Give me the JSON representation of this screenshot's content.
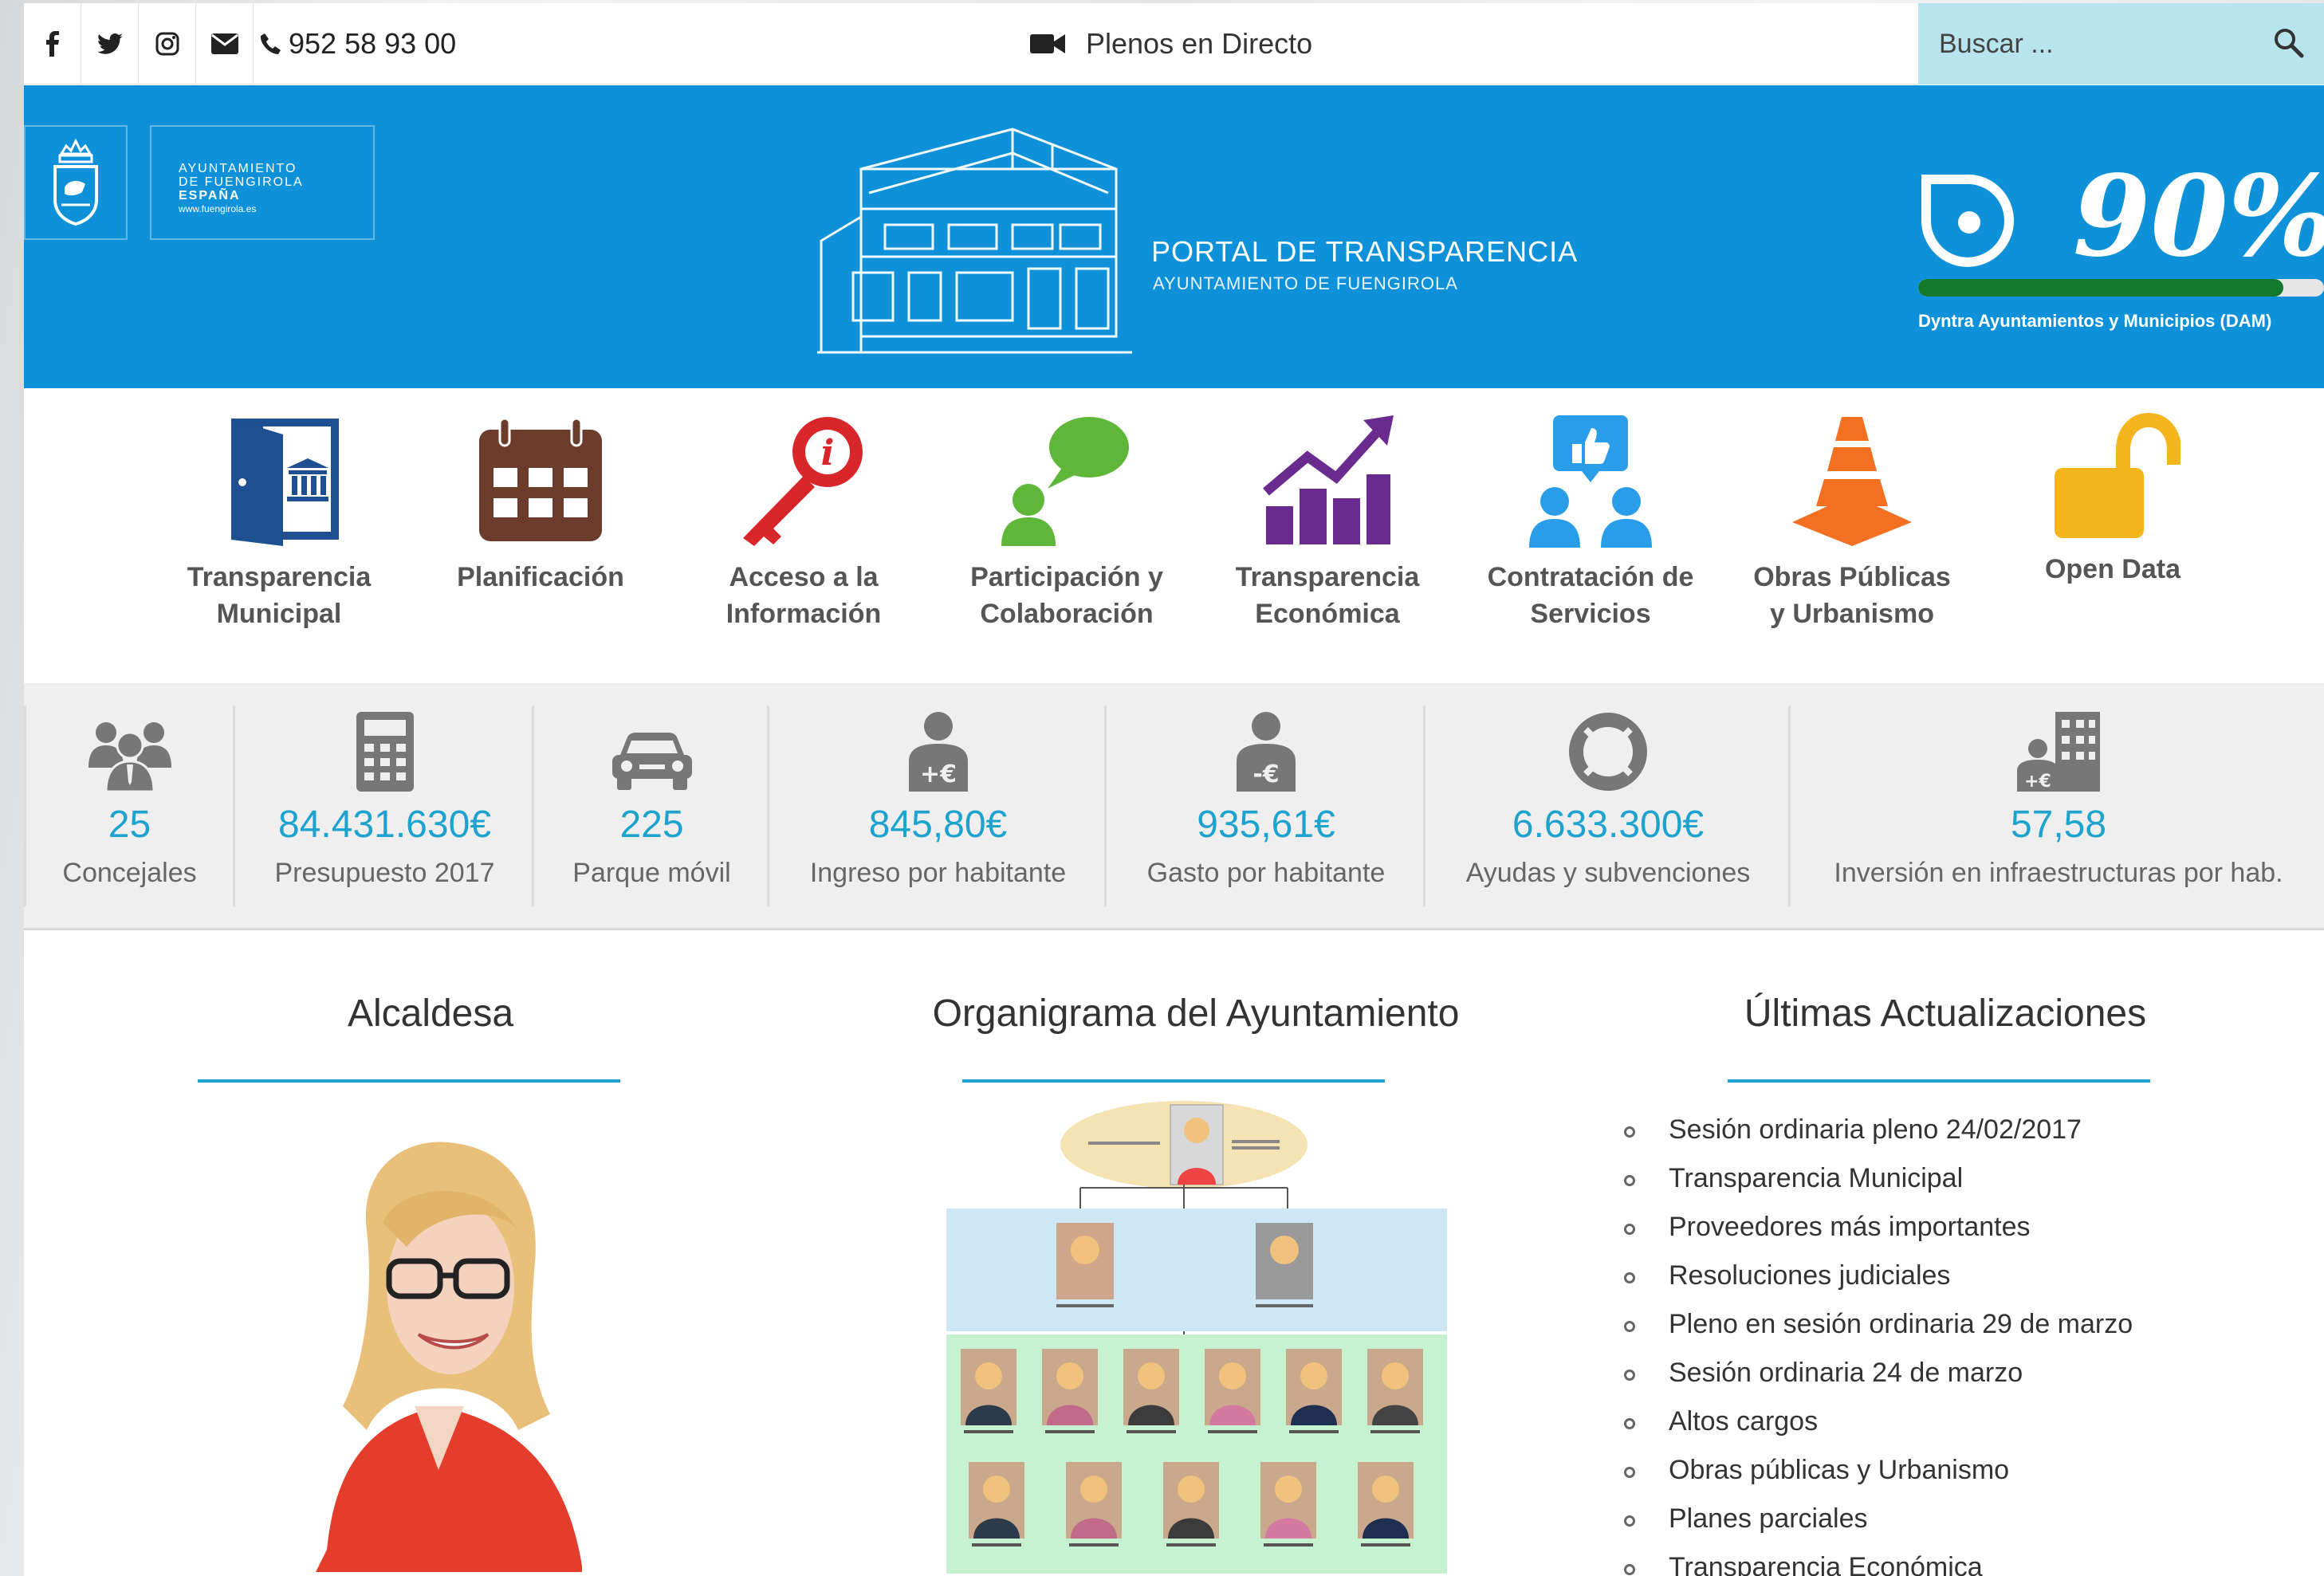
{
  "topbar": {
    "social": [
      "facebook-icon",
      "twitter-icon",
      "instagram-icon",
      "envelope-icon"
    ],
    "phone": "952 58 93 00",
    "live_label": "Plenos en Directo",
    "search_placeholder": "Buscar ..."
  },
  "hero": {
    "logo_lines": [
      "AYUNTAMIENTO",
      "DE FUENGIROLA",
      "ESPAÑA",
      "www.fuengirola.es"
    ],
    "portal_title": "PORTAL DE TRANSPARENCIA",
    "portal_subtitle": "AYUNTAMIENTO DE FUENGIROLA",
    "score": "90%",
    "score_progress": 0.9,
    "score_label": "Dyntra Ayuntamientos y Municipios (DAM)"
  },
  "categories": [
    {
      "line1": "Transparencia",
      "line2": "Municipal",
      "icon": "door-icon",
      "color": "#1d4f91"
    },
    {
      "line1": "Planificación",
      "line2": "",
      "icon": "calendar-icon",
      "color": "#6b3c2c"
    },
    {
      "line1": "Acceso a la",
      "line2": "Información",
      "icon": "key-icon",
      "color": "#d8262a"
    },
    {
      "line1": "Participación y",
      "line2": "Colaboración",
      "icon": "chat-person-icon",
      "color": "#5fb73a"
    },
    {
      "line1": "Transparencia",
      "line2": "Económica",
      "icon": "growth-chart-icon",
      "color": "#6a2b8e"
    },
    {
      "line1": "Contratación de",
      "line2": "Servicios",
      "icon": "thumbs-up-people-icon",
      "color": "#2a9de8"
    },
    {
      "line1": "Obras Públicas",
      "line2": "y Urbanismo",
      "icon": "traffic-cone-icon",
      "color": "#f36f21"
    },
    {
      "line1": "Open Data",
      "line2": "",
      "icon": "unlock-icon",
      "color": "#f5b51d"
    }
  ],
  "stats": [
    {
      "value": "25",
      "caption": "Concejales",
      "icon": "group-icon"
    },
    {
      "value": "84.431.630€",
      "caption": "Presupuesto 2017",
      "icon": "calculator-icon"
    },
    {
      "value": "225",
      "caption": "Parque móvil",
      "icon": "car-icon"
    },
    {
      "value": "845,80€",
      "caption": "Ingreso por habitante",
      "icon": "person-plus-euro-icon"
    },
    {
      "value": "935,61€",
      "caption": "Gasto por habitante",
      "icon": "person-minus-euro-icon"
    },
    {
      "value": "6.633.300€",
      "caption": "Ayudas y subvenciones",
      "icon": "lifebuoy-icon"
    },
    {
      "value": "57,58",
      "caption": "Inversión en infraestructuras por hab.",
      "icon": "building-euro-icon"
    }
  ],
  "sections": {
    "mayor_title": "Alcaldesa",
    "org_title": "Organigrama del Ayuntamiento",
    "updates_title": "Últimas Actualizaciones"
  },
  "updates": [
    "Sesión ordinaria pleno 24/02/2017",
    "Transparencia Municipal",
    "Proveedores más importantes",
    "Resoluciones judiciales",
    "Pleno en sesión ordinaria 29 de marzo",
    "Sesión ordinaria 24 de marzo",
    "Altos cargos",
    "Obras públicas y Urbanismo",
    "Planes parciales",
    "Transparencia Económica"
  ],
  "colors": {
    "hero_blue": "#0e91d8",
    "accent_teal": "#1ea3cf",
    "search_bg": "#b8e4ee",
    "score_green": "#137a2d"
  }
}
